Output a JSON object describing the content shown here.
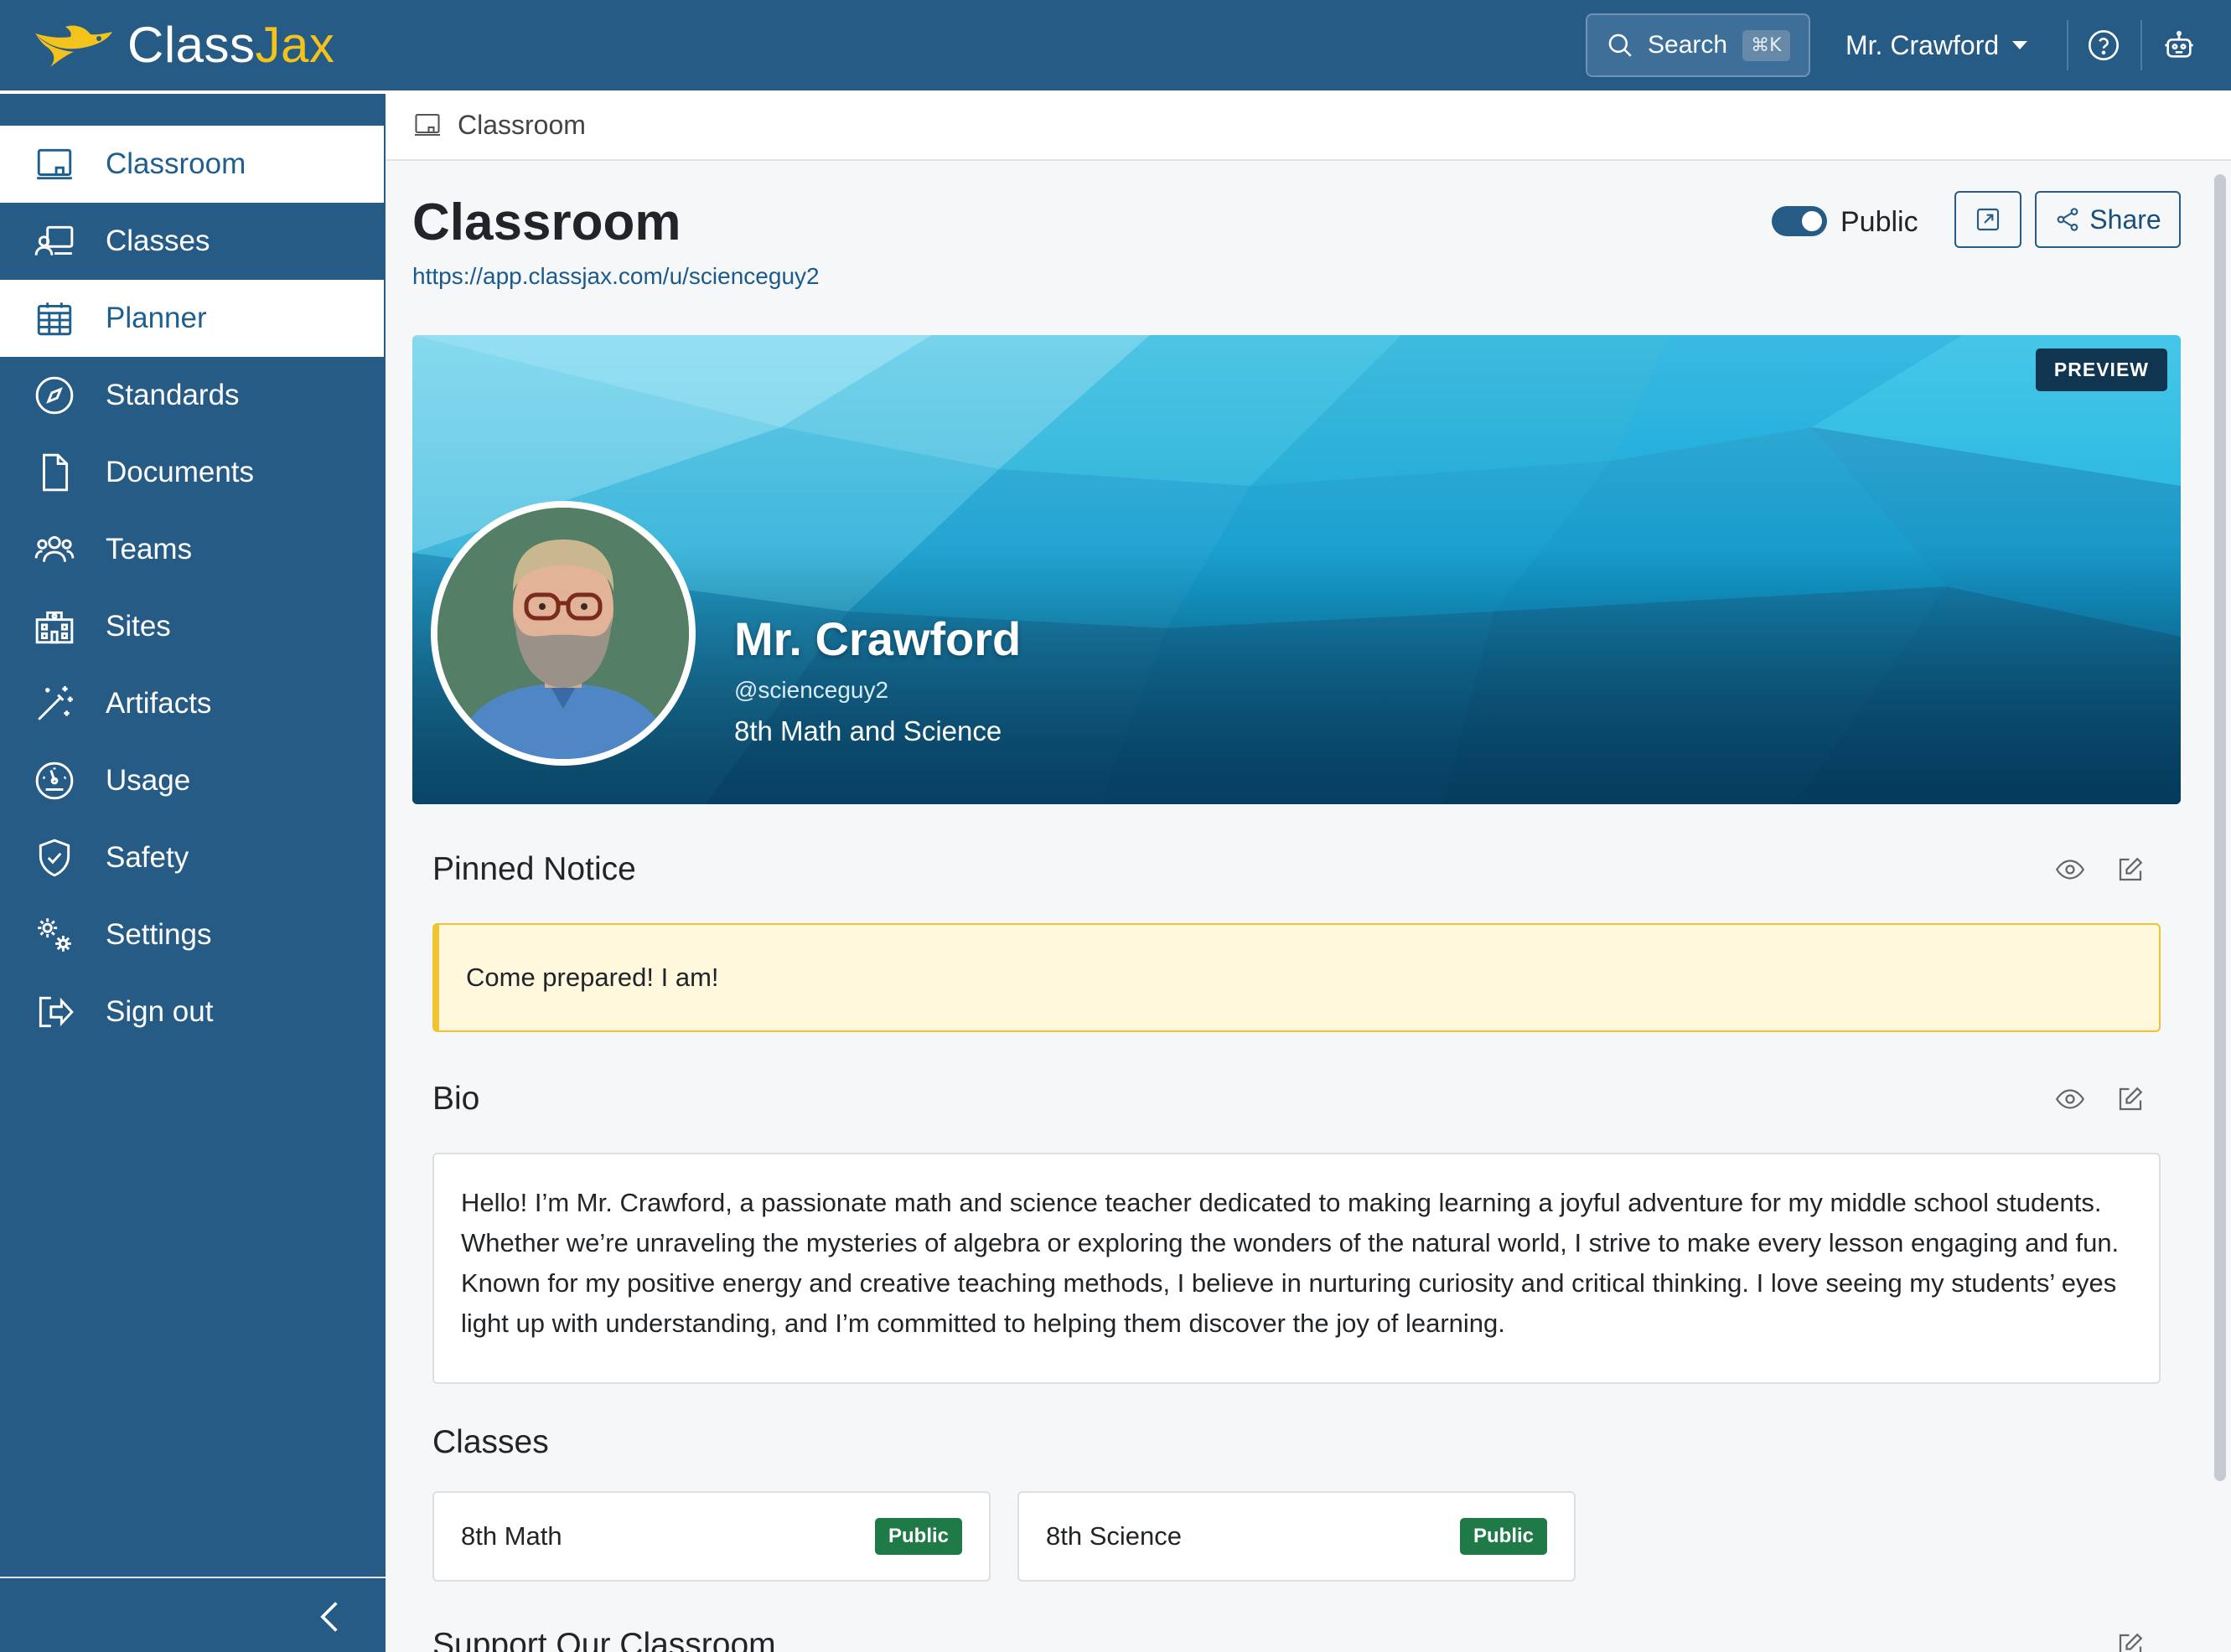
{
  "app": {
    "brand_part1": "Class",
    "brand_part2": "Jax",
    "brand_accent_color": "#f3c21b",
    "primary_color": "#265b86"
  },
  "topbar": {
    "search_label": "Search",
    "search_shortcut": "⌘K",
    "user_name": "Mr. Crawford",
    "help_icon": "help-circle-icon",
    "assistant_icon": "robot-icon"
  },
  "sidebar": {
    "items": [
      {
        "label": "Classroom",
        "icon": "classroom-icon",
        "active": true
      },
      {
        "label": "Classes",
        "icon": "classes-icon",
        "active": false
      },
      {
        "label": "Planner",
        "icon": "calendar-icon",
        "active": true
      },
      {
        "label": "Standards",
        "icon": "compass-icon",
        "active": false
      },
      {
        "label": "Documents",
        "icon": "document-icon",
        "active": false
      },
      {
        "label": "Teams",
        "icon": "team-icon",
        "active": false
      },
      {
        "label": "Sites",
        "icon": "building-icon",
        "active": false
      },
      {
        "label": "Artifacts",
        "icon": "magic-wand-icon",
        "active": false
      },
      {
        "label": "Usage",
        "icon": "gauge-icon",
        "active": false
      },
      {
        "label": "Safety",
        "icon": "shield-check-icon",
        "active": false
      },
      {
        "label": "Settings",
        "icon": "gears-icon",
        "active": false
      },
      {
        "label": "Sign out",
        "icon": "sign-out-icon",
        "active": false
      }
    ],
    "collapse_icon": "chevron-left-icon"
  },
  "breadcrumb": {
    "label": "Classroom"
  },
  "page": {
    "title": "Classroom",
    "url": "https://app.classjax.com/u/scienceguy2",
    "visibility_label": "Public",
    "visibility_on": true,
    "share_label": "Share"
  },
  "banner": {
    "preview_label": "PREVIEW",
    "name": "Mr. Crawford",
    "handle": "@scienceguy2",
    "subtitle": "8th Math and Science"
  },
  "pinned_notice": {
    "title": "Pinned Notice",
    "text": "Come prepared! I am!"
  },
  "bio": {
    "title": "Bio",
    "text": "Hello! I’m Mr. Crawford, a passionate math and science teacher dedicated to making learning a joyful adventure for my middle school students. Whether we’re unraveling the mysteries of algebra or exploring the wonders of the natural world, I strive to make every lesson engaging and fun. Known for my positive energy and creative teaching methods, I believe in nurturing curiosity and critical thinking. I love seeing my students’ eyes light up with understanding, and I’m committed to helping them discover the joy of learning."
  },
  "classes": {
    "title": "Classes",
    "items": [
      {
        "name": "8th Math",
        "badge": "Public"
      },
      {
        "name": "8th Science",
        "badge": "Public"
      }
    ]
  },
  "support": {
    "title": "Support Our Classroom"
  }
}
